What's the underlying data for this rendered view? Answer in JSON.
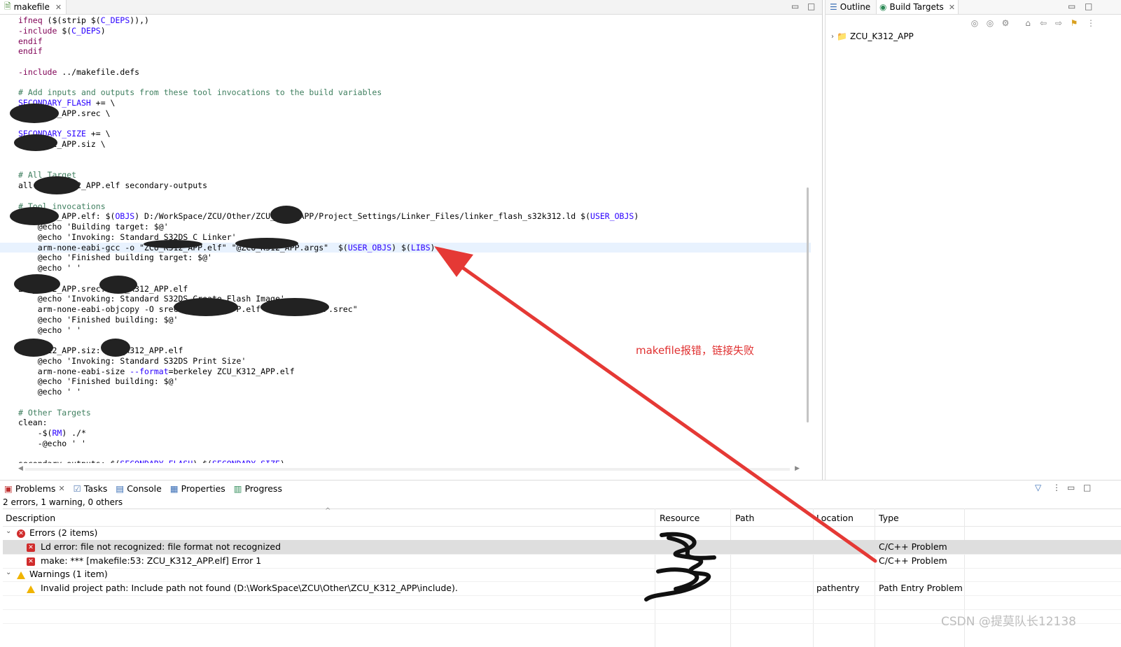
{
  "editor": {
    "tab_label": "makefile",
    "code_lines": [
      "ifneq ($(strip $(C_DEPS)),)",
      "-include $(C_DEPS)",
      "endif",
      "endif",
      "",
      "-include ../makefile.defs",
      "",
      "# Add inputs and outputs from these tool invocations to the build variables",
      "SECONDARY_FLASH += \\",
      "ZCU_K312_APP.srec \\",
      "",
      "SECONDARY_SIZE += \\",
      "ZCU_K312_APP.siz \\",
      "",
      "",
      "# All Target",
      "all: ZCU_K312_APP.elf secondary-outputs",
      "",
      "# Tool invocations",
      "ZCU_K312_APP.elf: $(OBJS) D:/WorkSpace/ZCU/Other/ZCU_K312_APP/Project_Settings/Linker_Files/linker_flash_s32k312.ld $(USER_OBJS)",
      "\t@echo 'Building target: $@'",
      "\t@echo 'Invoking: Standard S32DS C Linker'",
      "\tarm-none-eabi-gcc -o \"ZCU_K312_APP.elf\" \"@ZCU_K312_APP.args\"  $(USER_OBJS) $(LIBS)",
      "\t@echo 'Finished building target: $@'",
      "\t@echo ' '",
      "",
      "ZCU_K312_APP.srec: ZCU_K312_APP.elf",
      "\t@echo 'Invoking: Standard S32DS Create Flash Image'",
      "\tarm-none-eabi-objcopy -O srec ZCU_K312_APP.elf \"ZCU_K312_APP.srec\"",
      "\t@echo 'Finished building: $@'",
      "\t@echo ' '",
      "",
      "ZCU_K312_APP.siz: ZCU_K312_APP.elf",
      "\t@echo 'Invoking: Standard S32DS Print Size'",
      "\tarm-none-eabi-size --format=berkeley ZCU_K312_APP.elf",
      "\t@echo 'Finished building: $@'",
      "\t@echo ' '",
      "",
      "# Other Targets",
      "clean:",
      "\t-$(RM) ./*",
      "\t-@echo ' '",
      "",
      "secondary-outputs: $(SECONDARY_FLASH) $(SECONDARY_SIZE)"
    ]
  },
  "right_pane": {
    "tab_outline": "Outline",
    "tab_build_targets": "Build Targets",
    "tree_root": "ZCU_K312_APP"
  },
  "bottom": {
    "tabs": {
      "problems": "Problems",
      "tasks": "Tasks",
      "console": "Console",
      "properties": "Properties",
      "progress": "Progress"
    },
    "summary": "2 errors, 1 warning, 0 others",
    "columns": {
      "description": "Description",
      "resource": "Resource",
      "path": "Path",
      "location": "Location",
      "type": "Type"
    },
    "errors_group": "Errors (2 items)",
    "error1": "Ld error: file not recognized: file format not recognized",
    "error1_type": "C/C++ Problem",
    "error2": "make: *** [makefile:53: ZCU_K312_APP.elf] Error 1",
    "error2_type": "C/C++ Problem",
    "warnings_group": "Warnings (1 item)",
    "warning1": "Invalid project path: Include path not found (D:\\WorkSpace\\ZCU\\Other\\ZCU_K312_APP\\include).",
    "warning1_location": "pathentry",
    "warning1_type": "Path Entry Problem"
  },
  "annotation": "makefile报错，链接失败",
  "watermark": "CSDN @提莫队长12138",
  "colors": {
    "arrow": "#e53935",
    "keyword": "#7f0055",
    "variable": "#2a00ff",
    "comment": "#3f7f5f",
    "highlight_line": "#e8f2fe"
  }
}
